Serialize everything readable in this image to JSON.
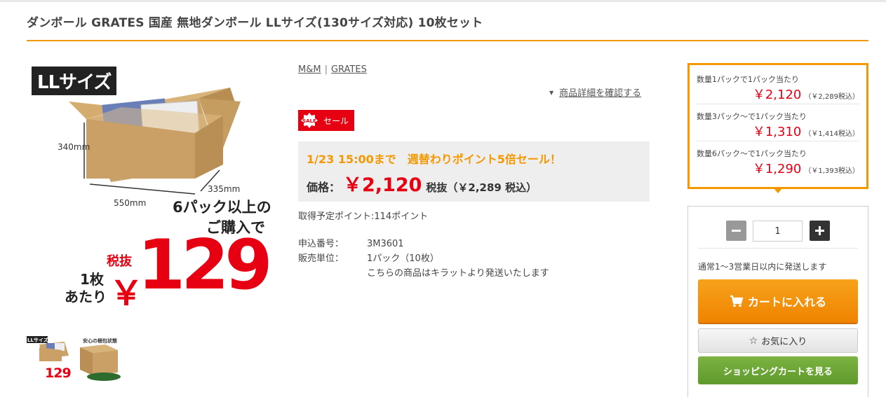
{
  "product": {
    "title": "ダンボール GRATES 国産 無地ダンボール LLサイズ(130サイズ対応) 10枚セット"
  },
  "image": {
    "size_tag": "LLサイズ",
    "dim_height": "340mm",
    "dim_width": "550mm",
    "dim_depth": "335mm",
    "promo_line1": "6パック以上の",
    "promo_line2": "ご購入で",
    "tax_label": "税抜",
    "unit_line1": "1枚",
    "unit_line2": "あたり",
    "yen": "￥",
    "promo_price": "129"
  },
  "thumbs": {
    "thumb1_tag": "LLサイズ",
    "thumb1_price": "129",
    "thumb2_tag": "安心の梱包状態"
  },
  "brand": {
    "links": [
      "M&M",
      "GRATES"
    ],
    "separator": "|"
  },
  "detail_link": "商品詳細を確認する",
  "sale": {
    "icon_text": "SALE",
    "label": "セール"
  },
  "price": {
    "campaign": "1/23 15:00まで　週替わりポイント5倍セール！",
    "label": "価格：",
    "main": "￥2,120",
    "sub": "税抜（￥2,289 税込）"
  },
  "points": "取得予定ポイント:114ポイント",
  "spec": [
    {
      "key": "申込番号：",
      "value": "3M3601"
    },
    {
      "key": "販売単位：",
      "value": "1パック（10枚）"
    },
    {
      "key": "",
      "value": "こちらの商品はキラットより発送いたします"
    }
  ],
  "tiers": [
    {
      "label": "数量1パックで1パック当たり",
      "price": "￥2,120",
      "tax": "（￥2,289税込）"
    },
    {
      "label": "数量3パック～で1パック当たり",
      "price": "￥1,310",
      "tax": "（￥1,414税込）"
    },
    {
      "label": "数量6パック～で1パック当たり",
      "price": "￥1,290",
      "tax": "（￥1,393税込）"
    }
  ],
  "cart": {
    "quantity": "1",
    "ship_note": "通常1～3営業日以内に発送します",
    "add_to_cart": "カートに入れる",
    "favorite": "お気に入り",
    "view_cart": "ショッピングカートを見る"
  },
  "colors": {
    "accent_orange": "#f39800",
    "sale_red": "#e60012",
    "cart_green": "#6aa535"
  },
  "icons": [
    "cart-icon",
    "star-outline-icon",
    "minus-icon",
    "plus-icon",
    "sale-tag-icon"
  ]
}
